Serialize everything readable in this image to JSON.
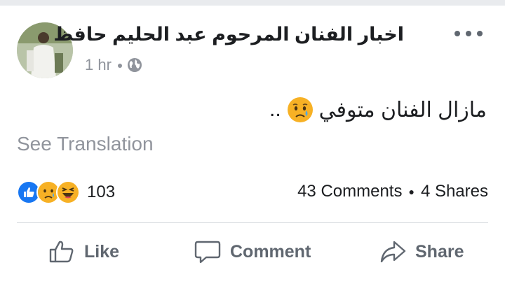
{
  "post": {
    "page_name": "اخبار الفنان المرحوم عبد الحليم حافظ",
    "time": "1 hr",
    "audience_icon": "globe-icon",
    "text": "مازال الفنان متوفي",
    "text_tail": "..",
    "text_emoji": "sad-tear-emoji",
    "see_translation": "See Translation"
  },
  "engagement": {
    "reaction_icons": [
      "like-reaction-icon",
      "sad-reaction-icon",
      "haha-reaction-icon"
    ],
    "reaction_count": "103",
    "comments": "43 Comments",
    "shares": "4 Shares"
  },
  "actions": {
    "like": "Like",
    "comment": "Comment",
    "share": "Share"
  },
  "colors": {
    "facebook_blue": "#1877f2",
    "muted_text": "#90949c",
    "action_gray": "#606770",
    "divider": "#dadde1",
    "emoji_yellow": "#f7b125"
  }
}
